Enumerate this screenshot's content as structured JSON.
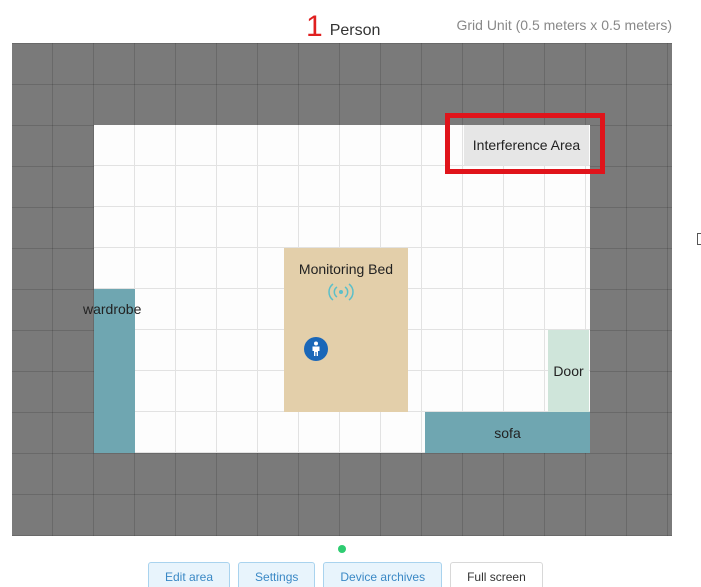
{
  "header": {
    "person_count": "1",
    "person_label": "Person",
    "grid_unit": "Grid Unit (0.5 meters x 0.5 meters)"
  },
  "map": {
    "zones": {
      "interference": "Interference Area",
      "bed": "Monitoring Bed",
      "wardrobe": "wardrobe",
      "door": "Door",
      "sofa": "sofa"
    },
    "colors": {
      "outside": "#7a7a7a",
      "room": "#fdfdfd",
      "bed": "#e3cfaa",
      "furniture": "#6fa6b1",
      "door": "#cfe5da",
      "highlight": "#e0141b"
    }
  },
  "status": {
    "online_color": "#2ecc71"
  },
  "toolbar": {
    "edit_area": "Edit area",
    "settings": "Settings",
    "device_archives": "Device archives",
    "full_screen": "Full screen"
  }
}
